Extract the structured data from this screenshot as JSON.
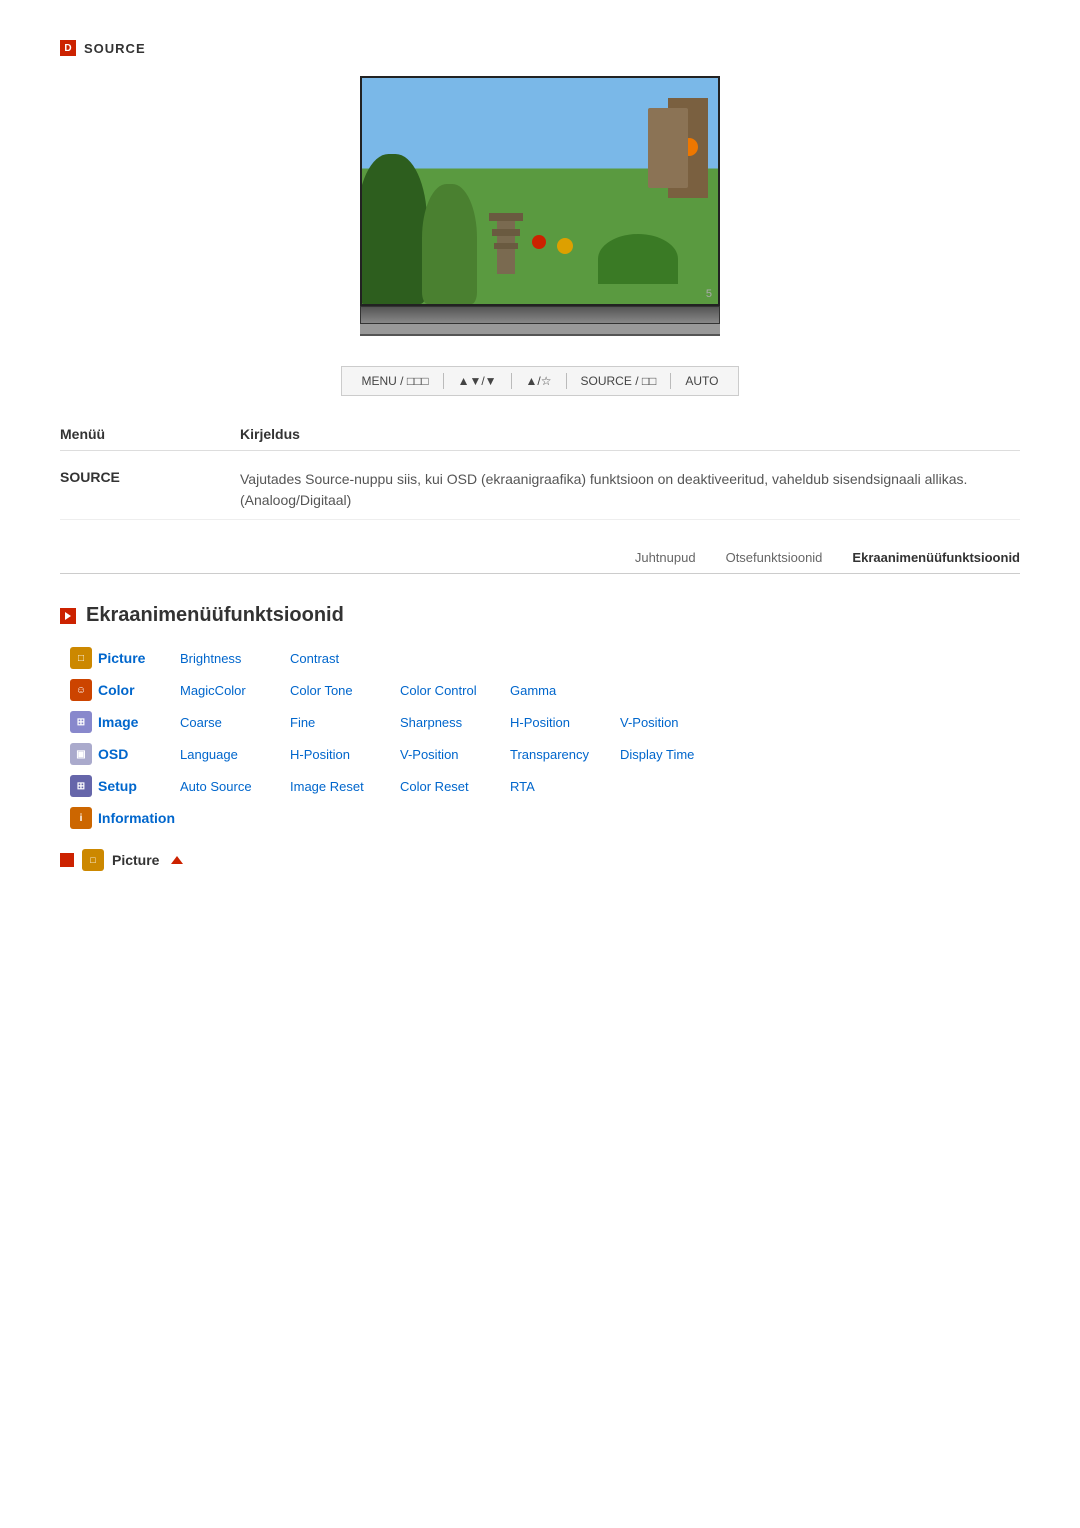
{
  "source_header": {
    "icon": "D",
    "label": "SOURCE"
  },
  "monitor_number": "5",
  "control_bar": {
    "items": [
      "MENU / □□□",
      "▲▼/▼",
      "▲/☆",
      "SOURCE / □□",
      "AUTO"
    ]
  },
  "description_table": {
    "col1_header": "Menüü",
    "col2_header": "Kirjeldus",
    "rows": [
      {
        "menu": "SOURCE",
        "desc": "Vajutades Source-nuppu siis, kui OSD (ekraanigraafika) funktsioon on deaktiveeritud, vaheldub sisendsignaali allikas. (Analoog/Digitaal)"
      }
    ]
  },
  "tabs": [
    {
      "label": "Juhtnupud",
      "active": false
    },
    {
      "label": "Otsefunktsioonid",
      "active": false
    },
    {
      "label": "Ekraanimenüüfunktsioonid",
      "active": true
    }
  ],
  "section": {
    "title": "Ekraanimenüüfunktsioonid"
  },
  "menu_grid": {
    "rows": [
      {
        "cat_key": "picture",
        "cat_label": "Picture",
        "links": [
          "Brightness",
          "Contrast",
          "",
          "",
          ""
        ]
      },
      {
        "cat_key": "color",
        "cat_label": "Color",
        "links": [
          "MagicColor",
          "Color Tone",
          "Color Control",
          "Gamma",
          ""
        ]
      },
      {
        "cat_key": "image",
        "cat_label": "Image",
        "links": [
          "Coarse",
          "Fine",
          "Sharpness",
          "H-Position",
          "V-Position"
        ]
      },
      {
        "cat_key": "osd",
        "cat_label": "OSD",
        "links": [
          "Language",
          "H-Position",
          "V-Position",
          "Transparency",
          "Display Time"
        ]
      },
      {
        "cat_key": "setup",
        "cat_label": "Setup",
        "links": [
          "Auto Source",
          "Image Reset",
          "Color Reset",
          "RTA",
          ""
        ]
      },
      {
        "cat_key": "information",
        "cat_label": "Information",
        "links": [
          "",
          "",
          "",
          "",
          ""
        ]
      }
    ]
  },
  "picture_footer": {
    "label": "Picture",
    "arrow": "▲"
  }
}
